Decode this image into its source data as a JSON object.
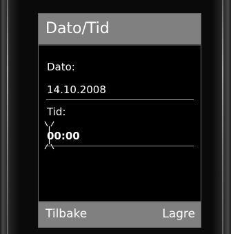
{
  "screen": {
    "title": "Dato/Tid"
  },
  "date_field": {
    "label": "Dato:",
    "value": "14.10.2008"
  },
  "time_field": {
    "label": "Tid:",
    "value": "00:00",
    "cursor_icon": "blinking-cursor-icon"
  },
  "softkeys": {
    "left_label": "Tilbake",
    "right_label": "Lagre"
  },
  "colors": {
    "title_bar": "#808080",
    "screen_background": "#000000",
    "text": "#ffffff",
    "softkey_bar": "#808080"
  }
}
